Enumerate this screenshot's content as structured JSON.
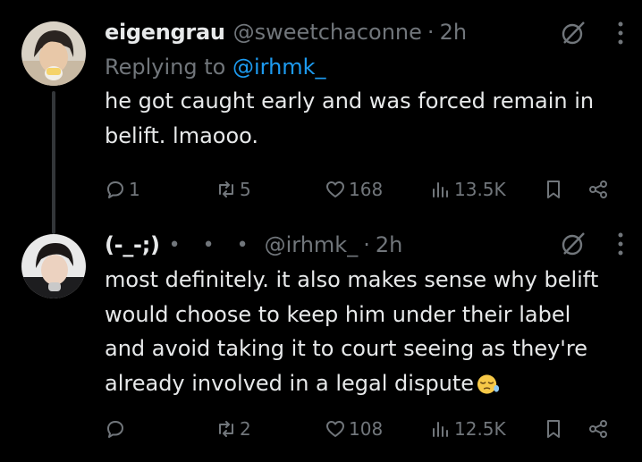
{
  "posts": [
    {
      "name": "eigengrau",
      "handle": "@sweetchaconne",
      "separator": "·",
      "time": "2h",
      "reply_prefix": "Replying to",
      "reply_mention": "@irhmk_",
      "text": "he got caught early and was forced remain in\nbelift. lmaooo.",
      "metrics": {
        "replies": "1",
        "reposts": "5",
        "likes": "168",
        "views": "13.5K"
      },
      "avatar_icon": "avatar-photo"
    },
    {
      "name": "(-_-;)",
      "badge": "• • •",
      "handle": "@irhmk_",
      "separator": "·",
      "time": "2h",
      "text": "most definitely. it also makes sense why belift\nwould choose to keep him under their label\nand avoid taking it to court seeing as they're\nalready involved in a legal dispute",
      "emoji": "sleepy-face-emoji",
      "metrics": {
        "replies": "",
        "reposts": "2",
        "likes": "108",
        "views": "12.5K"
      },
      "avatar_icon": "avatar-photo"
    }
  ],
  "icons": {
    "reply": "reply-icon",
    "repost": "repost-icon",
    "like": "heart-icon",
    "views": "views-icon",
    "bookmark": "bookmark-icon",
    "share": "share-icon",
    "grok": "grok-icon",
    "more": "more-icon"
  },
  "colors": {
    "background": "#000000",
    "text": "#e7e9ea",
    "muted": "#71767b",
    "link": "#1d9bf0",
    "thread_line": "#333639"
  }
}
